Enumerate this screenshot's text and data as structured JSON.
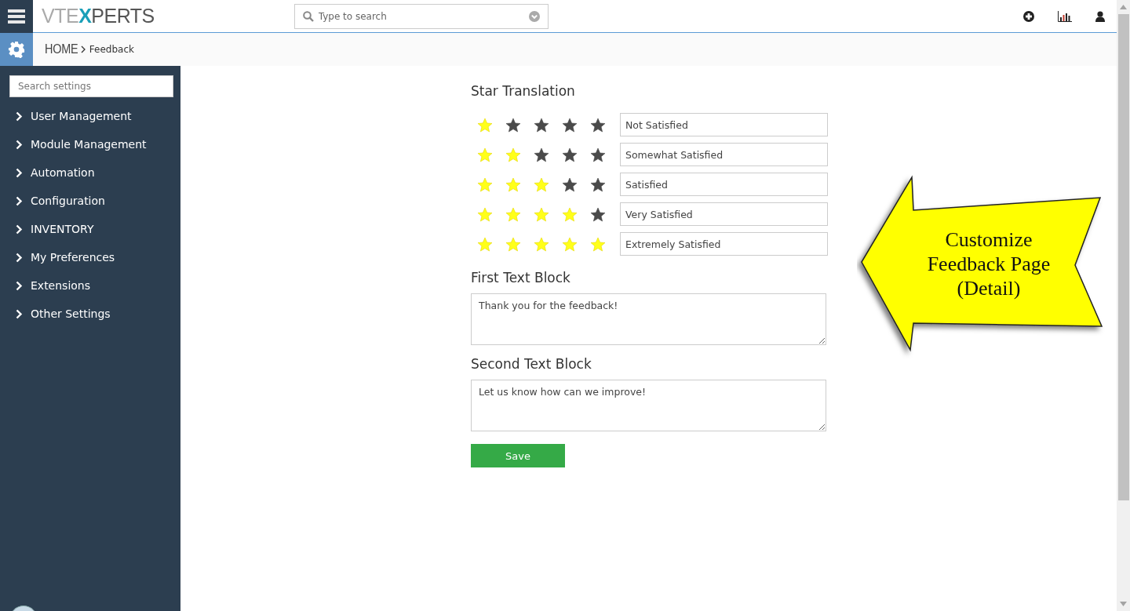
{
  "header": {
    "logo": {
      "parts": [
        "VTE",
        "X",
        "PERTS"
      ]
    },
    "search": {
      "placeholder": "Type to search"
    }
  },
  "breadcrumb": [
    "HOME",
    "Feedback"
  ],
  "sidebar": {
    "search": {
      "placeholder": "Search settings"
    },
    "items": [
      {
        "label": "User Management"
      },
      {
        "label": "Module Management"
      },
      {
        "label": "Automation"
      },
      {
        "label": "Configuration"
      },
      {
        "label": "INVENTORY"
      },
      {
        "label": "My Preferences"
      },
      {
        "label": "Extensions"
      },
      {
        "label": "Other Settings"
      }
    ]
  },
  "star_translation": {
    "title": "Star Translation",
    "rows": [
      {
        "stars": 1,
        "value": "Not Satisfied"
      },
      {
        "stars": 2,
        "value": "Somewhat Satisfied"
      },
      {
        "stars": 3,
        "value": "Satisfied"
      },
      {
        "stars": 4,
        "value": "Very Satisfied"
      },
      {
        "stars": 5,
        "value": "Extremely Satisfied"
      }
    ]
  },
  "text_blocks": [
    {
      "title": "First Text Block",
      "value": "Thank you for the feedback!"
    },
    {
      "title": "Second Text Block",
      "value": "Let us know how can we improve!"
    }
  ],
  "save_button": "Save",
  "callout": {
    "lines": [
      "Customize",
      "Feedback Page",
      "(Detail)"
    ]
  }
}
